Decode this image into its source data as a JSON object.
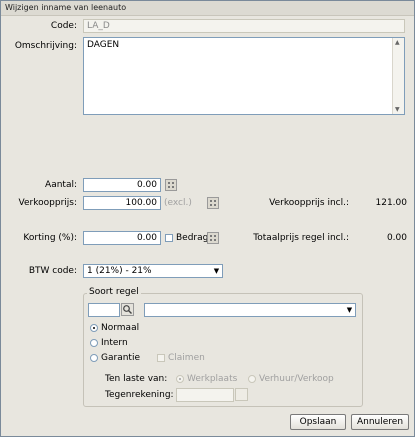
{
  "window": {
    "title": "Wijzigen inname van leenauto"
  },
  "form": {
    "code_label": "Code:",
    "code_value": "LA_D",
    "omschrijving_label": "Omschrijving:",
    "omschrijving_value": "DAGEN",
    "aantal_label": "Aantal:",
    "aantal_value": "0.00",
    "verkoopprijs_label": "Verkoopprijs:",
    "verkoopprijs_value": "100.00",
    "excl_label": "(excl.)",
    "verkoopprijs_incl_label": "Verkoopprijs incl.:",
    "verkoopprijs_incl_value": "121.00",
    "korting_label": "Korting (%):",
    "korting_value": "0.00",
    "bedrag_label": "Bedrag",
    "totaalprijs_label": "Totaalprijs regel incl.:",
    "totaalprijs_value": "0.00",
    "btw_label": "BTW code:",
    "btw_value": "1 (21%) - 21%"
  },
  "soort_regel": {
    "title": "Soort regel",
    "code_value": "",
    "description_value": "",
    "radio_normaal": "Normaal",
    "radio_intern": "Intern",
    "radio_garantie": "Garantie",
    "claimen_label": "Claimen",
    "ten_laste_label": "Ten laste van:",
    "option_werkplaats": "Werkplaats",
    "option_verkoop": "Verhuur/Verkoop",
    "tegenrekening_label": "Tegenrekening:",
    "tegenrekening_value": ""
  },
  "buttons": {
    "save": "Opslaan",
    "cancel": "Annuleren"
  },
  "icons": {
    "calculator": "calculator-icon",
    "search": "search-icon",
    "dropdown": "chevron-down-icon"
  }
}
